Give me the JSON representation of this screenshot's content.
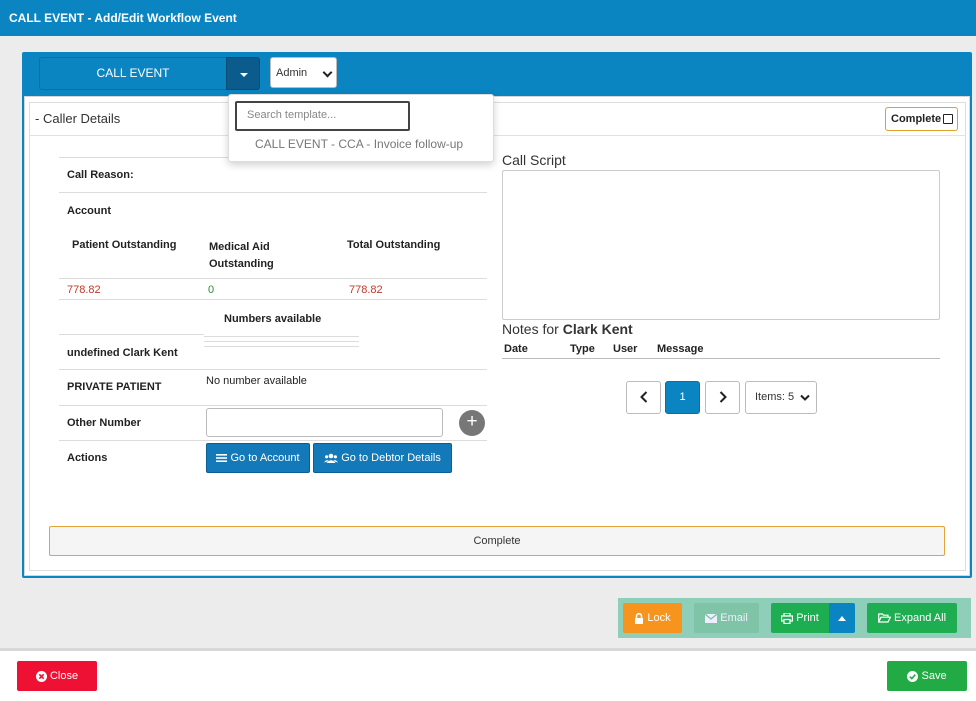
{
  "window": {
    "title": "CALL EVENT - Add/Edit Workflow Event"
  },
  "event_selector": {
    "label": "CALL EVENT"
  },
  "user_select": {
    "value": "Admin"
  },
  "template_dropdown": {
    "search_placeholder": "Search template...",
    "items": [
      "CALL EVENT - CCA - Invoice follow-up"
    ]
  },
  "caller_details": {
    "title": "Caller Details",
    "collapse_symbol": "-",
    "complete_toggle_label": "Complete",
    "call_reason_label": "Call Reason:",
    "account_label": "Account",
    "patient_outstanding_label": "Patient Outstanding",
    "medical_aid_outstanding_label_1": "Medical Aid",
    "medical_aid_outstanding_label_2": "Outstanding",
    "total_outstanding_label": "Total Outstanding",
    "patient_outstanding_value": "778.82",
    "medical_aid_outstanding_value": "0",
    "total_outstanding_value": "778.82",
    "numbers_available_label": "Numbers available",
    "contact_name": "undefined Clark Kent",
    "private_patient_label": "PRIVATE PATIENT",
    "no_number_text": "No number available",
    "other_number_label": "Other Number",
    "actions_label": "Actions",
    "go_to_account_label": "Go to Account",
    "go_to_debtor_label": "Go to Debtor Details"
  },
  "call_script": {
    "label": "Call Script"
  },
  "notes": {
    "label_prefix": "Notes for",
    "person": "Clark Kent",
    "columns": [
      "Date",
      "Type",
      "User",
      "Message"
    ],
    "pagination": {
      "current_page": "1",
      "items_per_page": "Items: 5"
    }
  },
  "complete_bar": {
    "label": "Complete"
  },
  "toolbar": {
    "lock_label": "Lock",
    "email_label": "Email",
    "print_label": "Print",
    "expand_all_label": "Expand All"
  },
  "footer": {
    "close_label": "Close",
    "save_label": "Save"
  },
  "colors": {
    "primary": "#0a85c2",
    "lock": "#f7941d",
    "email": "#7fc4a6",
    "print": "#1fad52",
    "close": "#ee1133",
    "save": "#22aa44",
    "negative_amount": "#c0392b",
    "positive_amount": "#2e8b3a"
  }
}
